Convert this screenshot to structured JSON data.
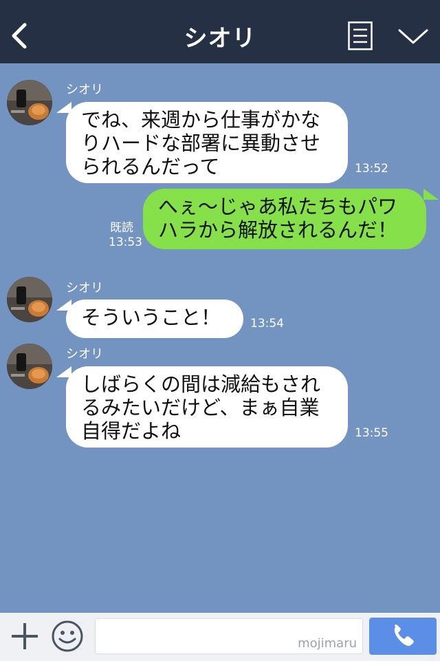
{
  "header": {
    "title": "シオリ",
    "back_icon": "chevron-left-icon",
    "menu_icon": "menu-list-icon",
    "collapse_icon": "chevron-down-icon"
  },
  "messages": [
    {
      "direction": "incoming",
      "sender": "シオリ",
      "text": "でね、来週から仕事がかな\nりハードな部署に異動させ\nられるんだって",
      "time": "13:52"
    },
    {
      "direction": "outgoing",
      "read": "既読",
      "text": "へぇ～じゃあ私たちもパワ\nハラから解放されるんだ！",
      "time": "13:53"
    },
    {
      "direction": "incoming",
      "sender": "シオリ",
      "text": "そういうこと！",
      "time": "13:54"
    },
    {
      "direction": "incoming",
      "sender": "シオリ",
      "text": "しばらくの間は減給もされ\nるみたいだけど、まぁ自業\n自得だよね",
      "time": "13:55"
    }
  ],
  "input": {
    "value": "",
    "watermark": "mojimaru",
    "plus_icon": "plus-icon",
    "emoji_icon": "smile-icon",
    "send_icon": "phone-icon"
  },
  "colors": {
    "header": "#263044",
    "chat_background": "#7393c1",
    "incoming_bubble": "#ffffff",
    "outgoing_bubble": "#86e04a",
    "send_button": "#5b8ee6"
  }
}
